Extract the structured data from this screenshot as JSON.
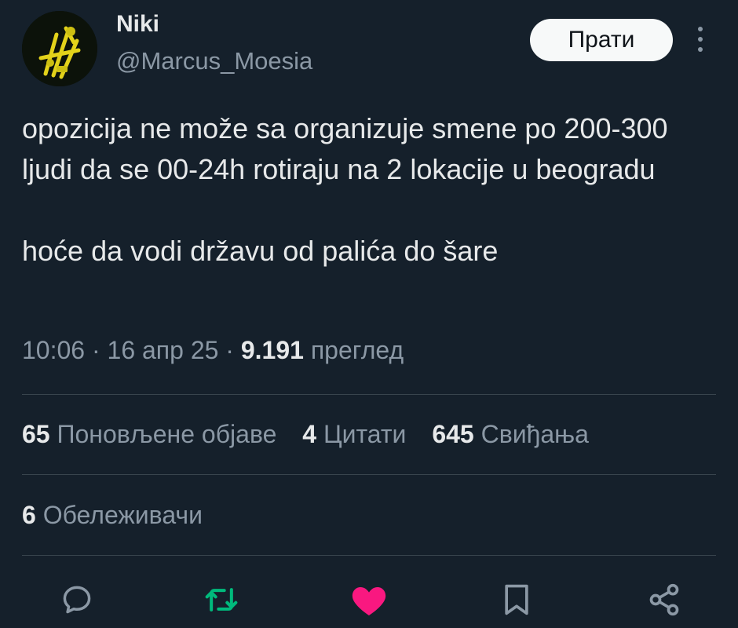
{
  "author": {
    "name": "Niki",
    "handle": "@Marcus_Moesia"
  },
  "follow_button": {
    "label": "Прати"
  },
  "tweet": {
    "paragraphs": [
      "opozicija ne može sa organizuje smene po 200-300 ljudi da se 00-24h rotiraju na 2 lokacije u beogradu",
      "hoće da vodi državu od palića do šare"
    ]
  },
  "meta": {
    "time": "10:06",
    "date": "16 апр 25",
    "views_count": "9.191",
    "views_label": "преглед",
    "separator": "·"
  },
  "stats": {
    "reposts_count": "65",
    "reposts_label": "Поновљене објаве",
    "quotes_count": "4",
    "quotes_label": "Цитати",
    "likes_count": "645",
    "likes_label": "Свиђања",
    "bookmarks_count": "6",
    "bookmarks_label": "Обележивачи"
  },
  "actions": {
    "reply_icon": "reply-icon",
    "retweet_icon": "retweet-icon",
    "like_icon": "heart-icon",
    "bookmark_icon": "bookmark-icon",
    "share_icon": "share-icon",
    "retweet_color": "#00ba7c",
    "like_color": "#f91880"
  },
  "colors": {
    "background": "#15202b",
    "text_primary": "#e7e9ea",
    "text_secondary": "#8b98a5",
    "divider": "#38444d"
  }
}
